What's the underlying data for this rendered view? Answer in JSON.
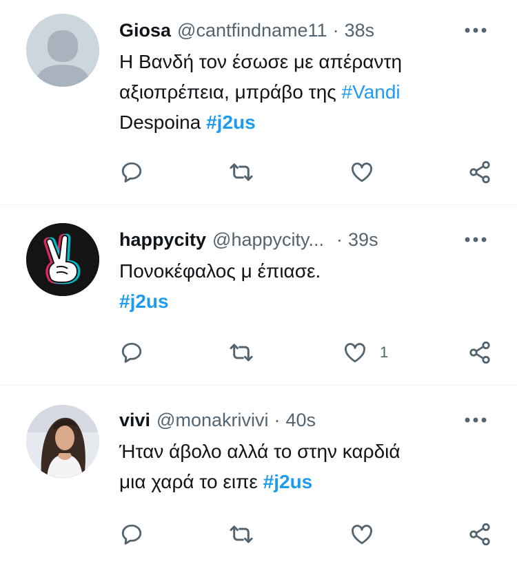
{
  "colors": {
    "accent": "#1d9bf0",
    "secondary_text": "#536471",
    "divider": "#eff3f4"
  },
  "tweets": [
    {
      "name": "Giosa",
      "handle": "@cantfindname11",
      "separator": "·",
      "time": "38s",
      "avatar": "default-avatar",
      "text": {
        "line1": "Η Βανδή τον έσωσε με απέραντη",
        "line2_plain": "αξιοπρέπεια, μπράβο της ",
        "line2_tag": "#Vandi",
        "line3_plain": "Despoina ",
        "line3_tag": "#j2us"
      },
      "like_count": ""
    },
    {
      "name": "happycity",
      "handle": "@happycity...",
      "separator": "·",
      "time": "39s",
      "avatar": "peace-sign-avatar",
      "text": {
        "line1": "Πονοκέφαλος μ έπιασε.",
        "line2_tag": "#j2us"
      },
      "like_count": "1"
    },
    {
      "name": "vivi",
      "handle": "@monakrivivi",
      "separator": "·",
      "time": "40s",
      "avatar": "photo-avatar",
      "text": {
        "line1": "Ήταν άβολο αλλά το στην καρδιά",
        "line2_plain": "μια χαρά το ειπε ",
        "line2_tag": "#j2us"
      },
      "like_count": ""
    }
  ]
}
